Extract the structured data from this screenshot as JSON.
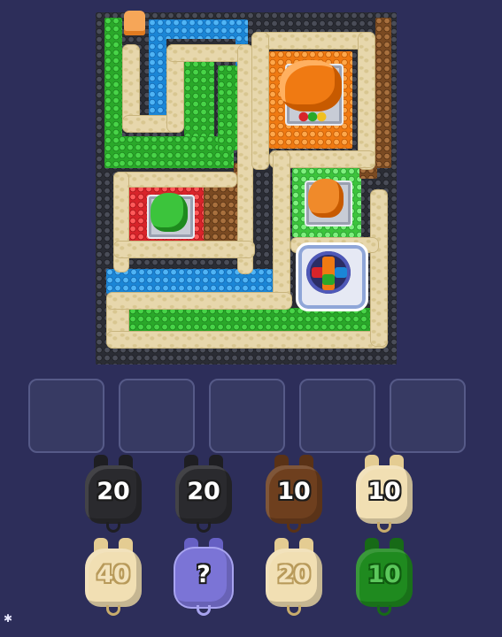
{
  "board": {
    "label": "puzzle-board"
  },
  "slots": [
    "",
    "",
    "",
    "",
    ""
  ],
  "queue": {
    "row1": [
      {
        "label": "20",
        "color": "#2a2a2e"
      },
      {
        "label": "20",
        "color": "#2a2a2e"
      },
      {
        "label": "10",
        "color": "#6e3f1e"
      },
      {
        "label": "10",
        "color": "#f1dfb3"
      }
    ],
    "row2": [
      {
        "label": "40",
        "color": "#f1dfb3"
      },
      {
        "label": "?",
        "color": "#7b74d6"
      },
      {
        "label": "20",
        "color": "#f1dfb3"
      },
      {
        "label": "10",
        "color": "#1f8a1f"
      }
    ]
  },
  "colors": {
    "background": "#2d2e5a",
    "green": "#2aa82a",
    "blue": "#1b86d6",
    "orange": "#f07a12",
    "red": "#d8242a",
    "brown": "#7a4a22",
    "path": "#e7d7ac"
  },
  "icons": {
    "corner": "sparkle-icon"
  }
}
